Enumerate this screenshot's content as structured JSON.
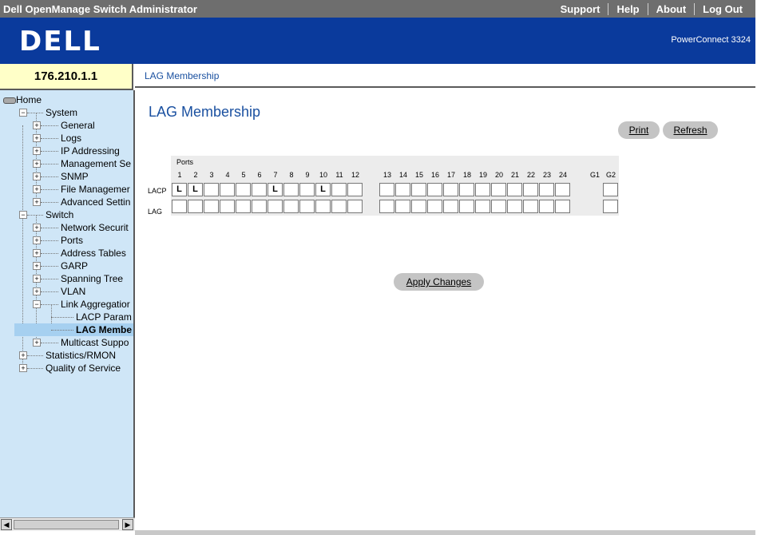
{
  "header": {
    "app_title": "Dell OpenManage Switch Administrator",
    "nav": [
      "Support",
      "Help",
      "About",
      "Log Out"
    ],
    "logo_text": "DELL",
    "model": "PowerConnect 3324",
    "brand_color": "#0a3a9c"
  },
  "ip_address": "176.210.1.1",
  "breadcrumb": "LAG Membership",
  "page_title": "LAG Membership",
  "buttons": {
    "print": "Print",
    "refresh": "Refresh",
    "apply": "Apply Changes"
  },
  "tree": [
    {
      "label": "Home"
    },
    {
      "label": "System"
    },
    {
      "label": "General"
    },
    {
      "label": "Logs"
    },
    {
      "label": "IP Addressing"
    },
    {
      "label": "Management Se"
    },
    {
      "label": "SNMP"
    },
    {
      "label": "File Managemer"
    },
    {
      "label": "Advanced Settin"
    },
    {
      "label": "Switch"
    },
    {
      "label": "Network Securit"
    },
    {
      "label": "Ports"
    },
    {
      "label": "Address Tables"
    },
    {
      "label": "GARP"
    },
    {
      "label": "Spanning Tree"
    },
    {
      "label": "VLAN"
    },
    {
      "label": "Link Aggregatior"
    },
    {
      "label": "LACP Param"
    },
    {
      "label": "LAG Membe",
      "selected": true
    },
    {
      "label": "Multicast Suppo"
    },
    {
      "label": "Statistics/RMON"
    },
    {
      "label": "Quality of Service"
    }
  ],
  "matrix": {
    "ports_label": "Ports",
    "row_labels": [
      "LACP",
      "LAG"
    ],
    "ports": [
      "1",
      "2",
      "3",
      "4",
      "5",
      "6",
      "7",
      "8",
      "9",
      "10",
      "11",
      "12",
      "13",
      "14",
      "15",
      "16",
      "17",
      "18",
      "19",
      "20",
      "21",
      "22",
      "23",
      "24",
      "G1",
      "G2"
    ],
    "lacp": [
      "L",
      "L",
      "",
      "",
      "",
      "",
      "L",
      "",
      "",
      "L",
      "",
      "",
      "",
      "",
      "",
      "",
      "",
      "",
      "",
      "",
      "",
      "",
      "",
      "",
      "",
      ""
    ],
    "lag": [
      "",
      "",
      "",
      "",
      "",
      "",
      "",
      "",
      "",
      "",
      "",
      "",
      "",
      "",
      "",
      "",
      "",
      "",
      "",
      "",
      "",
      "",
      "",
      "",
      "",
      ""
    ]
  }
}
